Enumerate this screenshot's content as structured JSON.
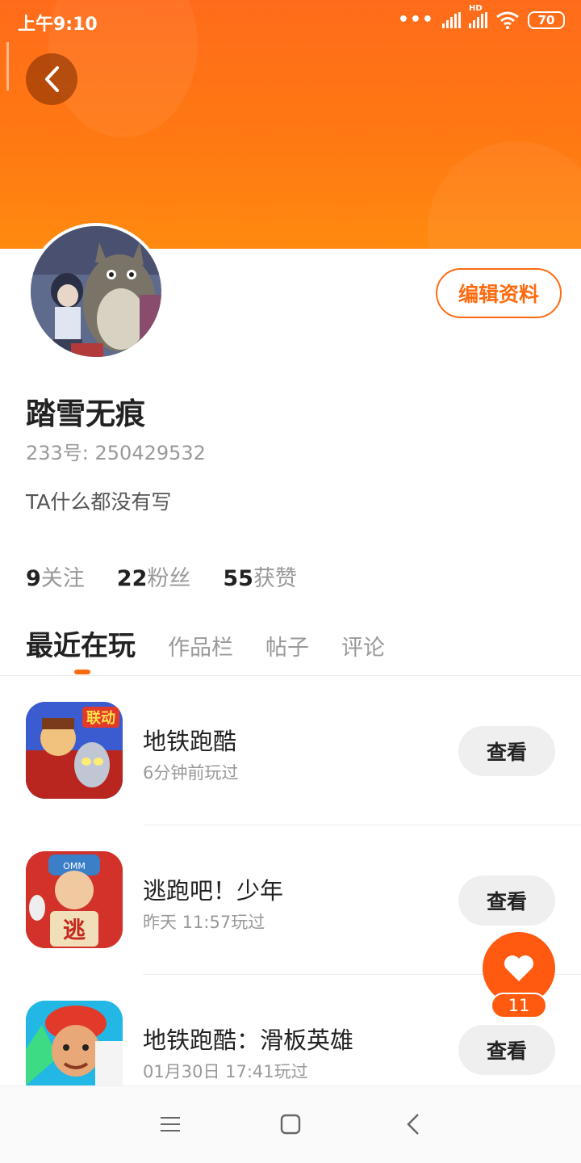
{
  "status_bar": {
    "time": "上午9:10",
    "signal_dots": "•••",
    "network_label": "HD",
    "battery": "70"
  },
  "profile": {
    "username": "踏雪无痕",
    "id_line": "233号: 250429532",
    "bio": "TA什么都没有写",
    "edit_label": "编辑资料"
  },
  "stats": [
    {
      "num": "9",
      "label": "关注"
    },
    {
      "num": "22",
      "label": "粉丝"
    },
    {
      "num": "55",
      "label": "获赞"
    }
  ],
  "tabs": [
    {
      "label": "最近在玩",
      "active": true
    },
    {
      "label": "作品栏",
      "active": false
    },
    {
      "label": "帖子",
      "active": false
    },
    {
      "label": "评论",
      "active": false
    }
  ],
  "games": [
    {
      "name": "地铁跑酷",
      "time": "6分钟前玩过",
      "button": "查看",
      "icon": "subway-surfers-ultraman-icon"
    },
    {
      "name": "逃跑吧！少年",
      "time": "昨天 11:57玩过",
      "button": "查看",
      "icon": "run-away-boy-icon"
    },
    {
      "name": "地铁跑酷：滑板英雄",
      "time": "01月30日 17:41玩过",
      "button": "查看",
      "icon": "subway-surfers-skate-icon"
    }
  ],
  "fab": {
    "count": "11",
    "icon": "heart-icon"
  },
  "colors": {
    "accent": "#ff6a10",
    "banner": "#ff7a12"
  }
}
